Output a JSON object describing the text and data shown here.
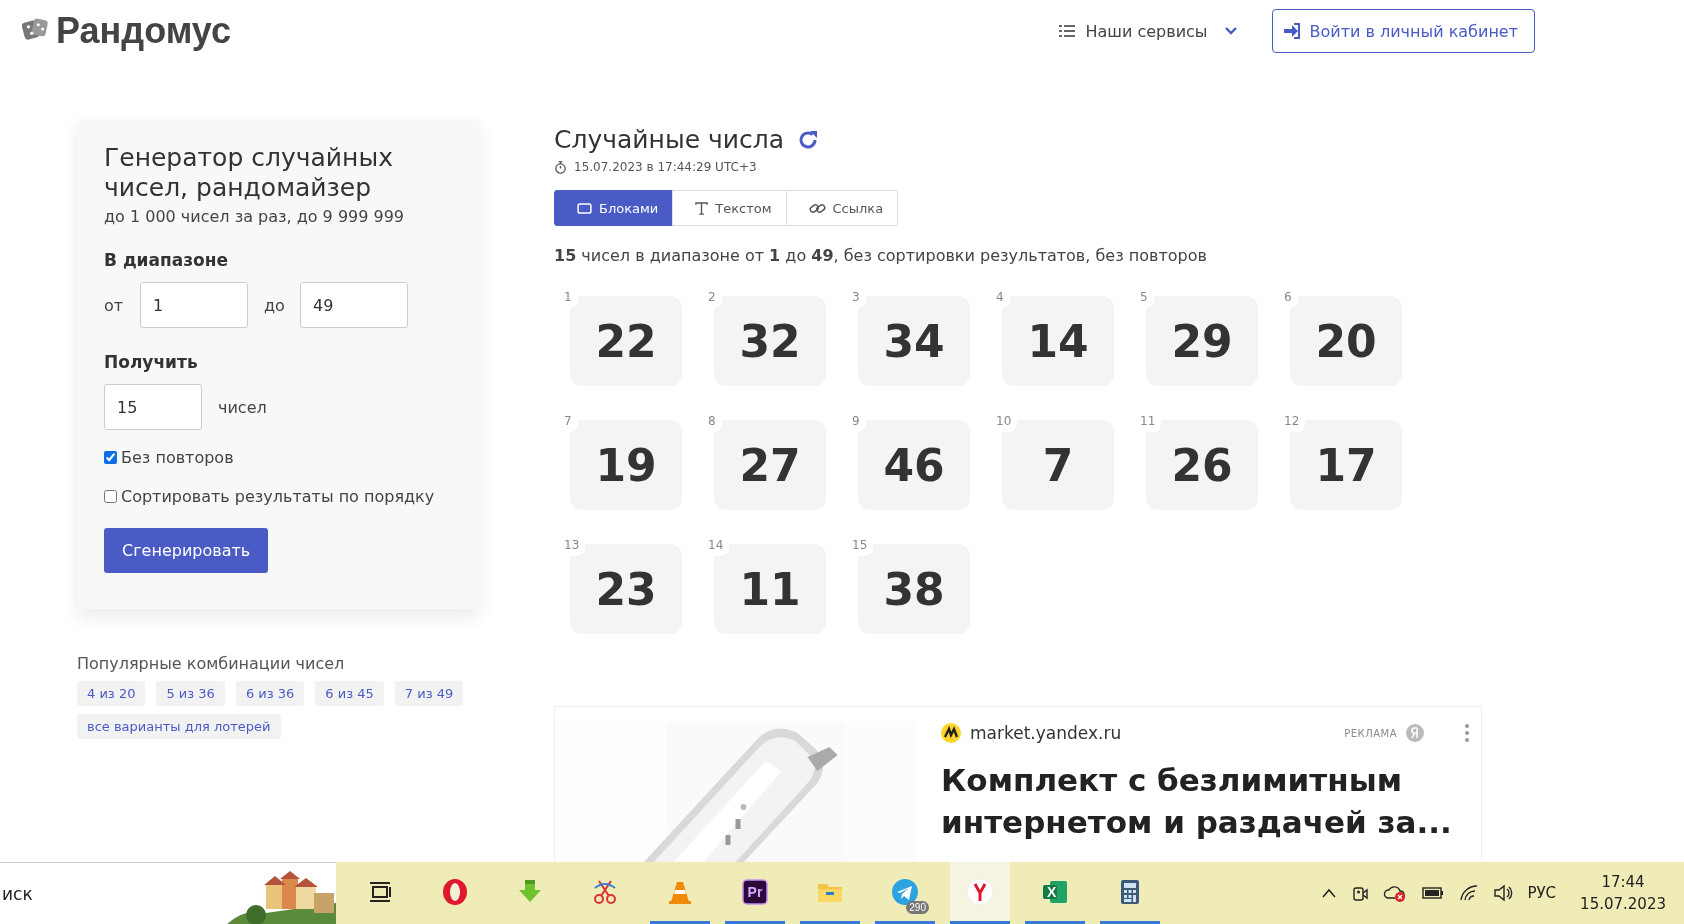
{
  "header": {
    "logo": "Рандомус",
    "services": "Наши сервисы",
    "login": "Войти в личный кабинет"
  },
  "form": {
    "title": "Генератор случайных чисел, рандомайзер",
    "subtitle": "до 1 000 чисел за раз, до 9 999 999",
    "range_label": "В диапазоне",
    "from_label": "от",
    "from_value": "1",
    "to_label": "до",
    "to_value": "49",
    "count_label": "Получить",
    "count_value": "15",
    "count_unit": "чисел",
    "checkboxes": [
      {
        "label": "Без повторов",
        "checked": true
      },
      {
        "label": "Сортировать результаты по порядку",
        "checked": false
      }
    ],
    "button": "Сгенерировать"
  },
  "popular": {
    "title": "Популярные комбинации чисел",
    "tags": [
      "4 из 20",
      "5 из 36",
      "6 из 36",
      "6 из 45",
      "7 из 49",
      "все варианты для лотерей"
    ]
  },
  "results": {
    "title": "Случайные числа",
    "timestamp": "15.07.2023 в 17:44:29 UTC+3",
    "tabs": [
      {
        "kind": "blocks",
        "label": "Блоками",
        "selected": true
      },
      {
        "kind": "text",
        "label": "Текстом",
        "selected": false
      },
      {
        "kind": "link",
        "label": "Ссылка",
        "selected": false
      }
    ],
    "summary": "**15** чисел в диапазоне от **1** до **49**, без сортировки результатов, без повторов",
    "numbers": [
      {
        "index": "1",
        "value": "22"
      },
      {
        "index": "2",
        "value": "32"
      },
      {
        "index": "3",
        "value": "34"
      },
      {
        "index": "4",
        "value": "14"
      },
      {
        "index": "5",
        "value": "29"
      },
      {
        "index": "6",
        "value": "20"
      },
      {
        "index": "7",
        "value": "19"
      },
      {
        "index": "8",
        "value": "27"
      },
      {
        "index": "9",
        "value": "46"
      },
      {
        "index": "10",
        "value": "7"
      },
      {
        "index": "11",
        "value": "26"
      },
      {
        "index": "12",
        "value": "17"
      },
      {
        "index": "13",
        "value": "23"
      },
      {
        "index": "14",
        "value": "11"
      },
      {
        "index": "15",
        "value": "38"
      }
    ]
  },
  "ad": {
    "source": "market.yandex.ru",
    "label": "РЕКЛАМА",
    "headline": "Комплект с безлимитным интернетом и раздачей за..."
  },
  "taskbar": {
    "search": "иск",
    "apps": [
      {
        "kind": "taskview",
        "running": false,
        "selected": false
      },
      {
        "kind": "opera",
        "running": false,
        "selected": false
      },
      {
        "kind": "download",
        "running": false,
        "selected": false
      },
      {
        "kind": "scissors",
        "running": false,
        "selected": false
      },
      {
        "kind": "vlc",
        "running": true,
        "selected": false
      },
      {
        "kind": "premiere",
        "label": "Pr",
        "running": true,
        "selected": false
      },
      {
        "kind": "folder",
        "running": true,
        "selected": false
      },
      {
        "kind": "telegram",
        "badge": "290",
        "running": true,
        "selected": false
      },
      {
        "kind": "yandex",
        "running": true,
        "selected": true
      },
      {
        "kind": "excel",
        "label": "X",
        "running": true,
        "selected": false
      },
      {
        "kind": "calculator",
        "running": true,
        "selected": false
      }
    ],
    "language": "РУС",
    "time": "17:44",
    "date": "15.07.2023"
  }
}
